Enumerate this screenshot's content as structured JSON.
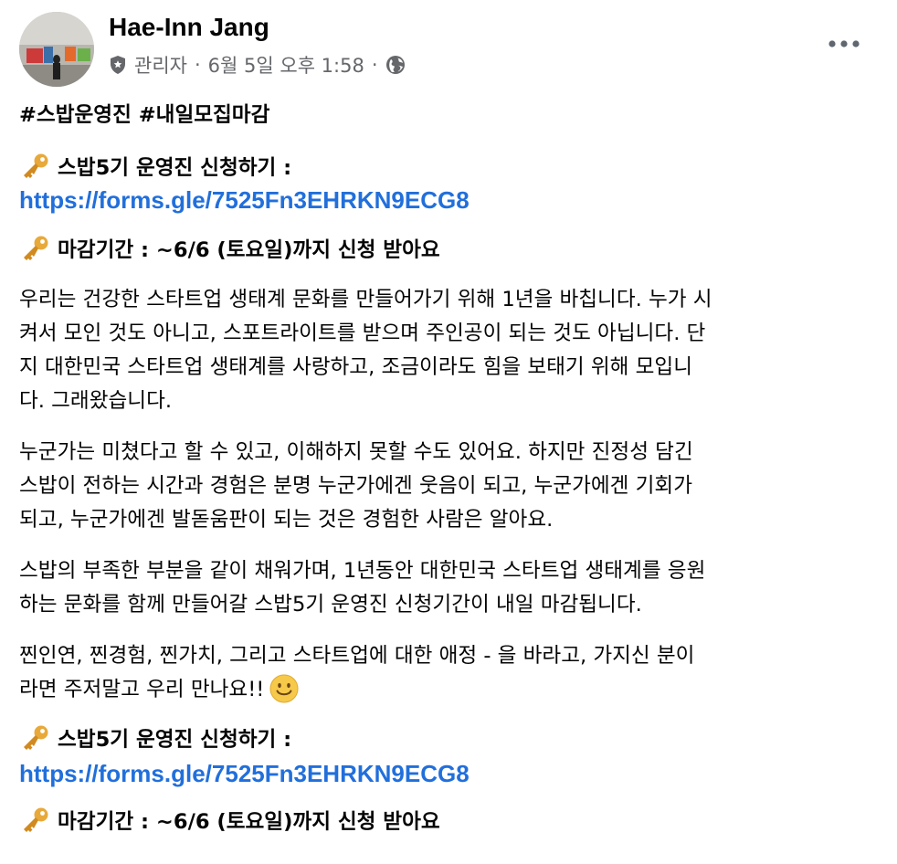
{
  "post": {
    "author": "Hae-Inn Jang",
    "role": "관리자",
    "separator": "·",
    "timestamp": "6월 5일 오후 1:58",
    "more_label": "•••",
    "hashtags": "#스밥운영진 #내일모집마감",
    "apply_label": "스밥5기 운영진 신청하기 :",
    "form_link": "https://forms.gle/7525Fn3EHRKN9ECG8",
    "deadline": "마감기간 : ~6/6 (토요일)까지 신청 받아요",
    "paragraph1": [
      "우리는 건강한 스타트업 생태계 문화를 만들어가기 위해 1년을 바칩니다. 누가 시",
      "켜서 모인 것도 아니고, 스포트라이트를 받으며 주인공이 되는 것도 아닙니다. 단",
      "지 대한민국 스타트업 생태계를 사랑하고, 조금이라도 힘을 보태기 위해 모입니",
      "다. 그래왔습니다."
    ],
    "paragraph2": [
      "누군가는 미쳤다고 할 수 있고, 이해하지 못할 수도 있어요. 하지만 진정성 담긴",
      "스밥이 전하는 시간과 경험은 분명 누군가에겐 웃음이 되고, 누군가에겐 기회가",
      "되고, 누군가에겐 발돋움판이 되는 것은 경험한 사람은 알아요."
    ],
    "paragraph3": [
      "스밥의 부족한 부분을 같이 채워가며, 1년동안 대한민국 스타트업 생태계를 응원",
      "하는 문화를 함께 만들어갈 스밥5기 운영진 신청기간이 내일 마감됩니다."
    ],
    "paragraph4": [
      "찐인연, 찐경험, 찐가치, 그리고 스타트업에 대한 애정 - 을 바라고, 가지신 분이",
      "라면 주저말고 우리 만나요!!"
    ]
  },
  "colors": {
    "text": "#050505",
    "secondary": "#65676b",
    "link": "#216fdb",
    "key_gold": "#e8a93a",
    "smile_yellow": "#f6c94a"
  },
  "icons": {
    "key": "key-icon",
    "smile": "smile-icon",
    "shield": "shield-icon",
    "globe": "globe-icon",
    "more": "more-dots-icon"
  }
}
